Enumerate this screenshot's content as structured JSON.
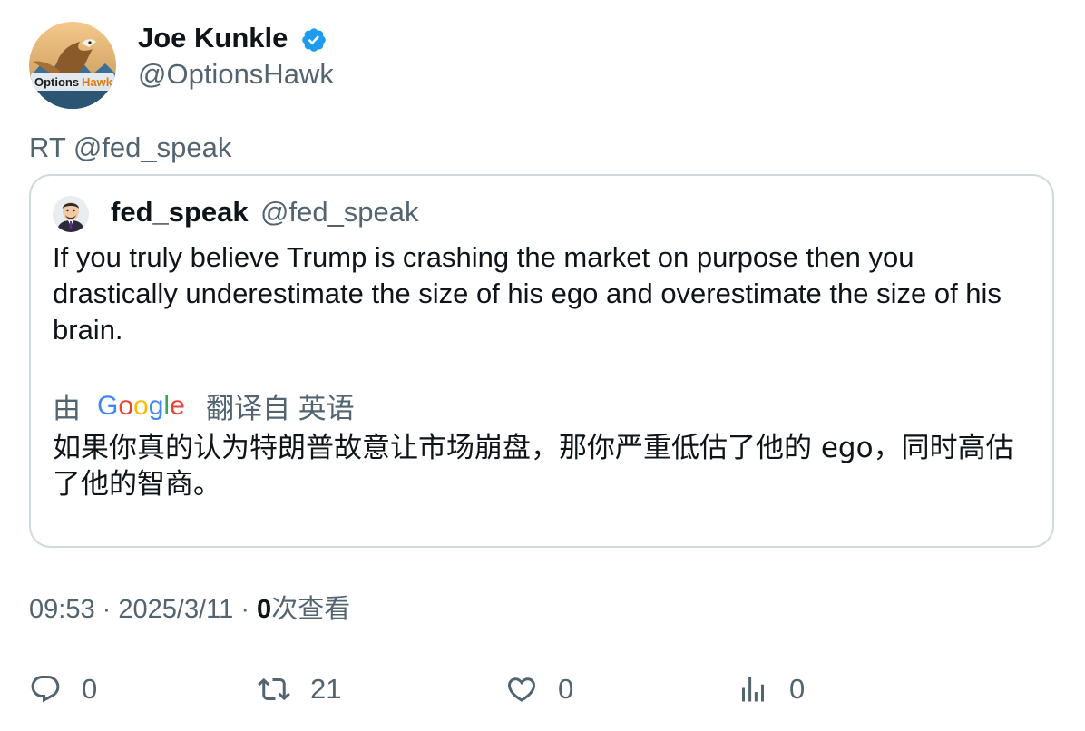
{
  "author": {
    "name": "Joe Kunkle",
    "handle": "@OptionsHawk",
    "avatar_text_1": "Options",
    "avatar_text_2": "Hawk"
  },
  "icons": {
    "verified": "verified-badge-icon",
    "reply": "reply-icon",
    "retweet": "retweet-icon",
    "like": "heart-icon",
    "views": "views-chart-icon"
  },
  "colors": {
    "verified_blue": "#1d9bf0",
    "text_primary": "#0f1419",
    "text_secondary": "#536471",
    "border": "#cfd9de"
  },
  "tweet": {
    "rt_text": "RT @fed_speak"
  },
  "quote": {
    "name": "fed_speak",
    "handle": "@fed_speak",
    "text": "If you truly believe Trump is crashing the market on purpose then you drastically underestimate the size of his ego and overestimate the size of his brain.",
    "translate_by": "由",
    "translate_from": "翻译自 英语",
    "translated_text": "如果你真的认为特朗普故意让市场崩盘，那你严重低估了他的 ego，同时高估了他的智商。"
  },
  "meta": {
    "time": "09:53",
    "sep": "·",
    "date": "2025/3/11",
    "views_count": "0",
    "views_label": "次查看"
  },
  "actions": {
    "replies": "0",
    "retweets": "21",
    "likes": "0",
    "views": "0"
  }
}
